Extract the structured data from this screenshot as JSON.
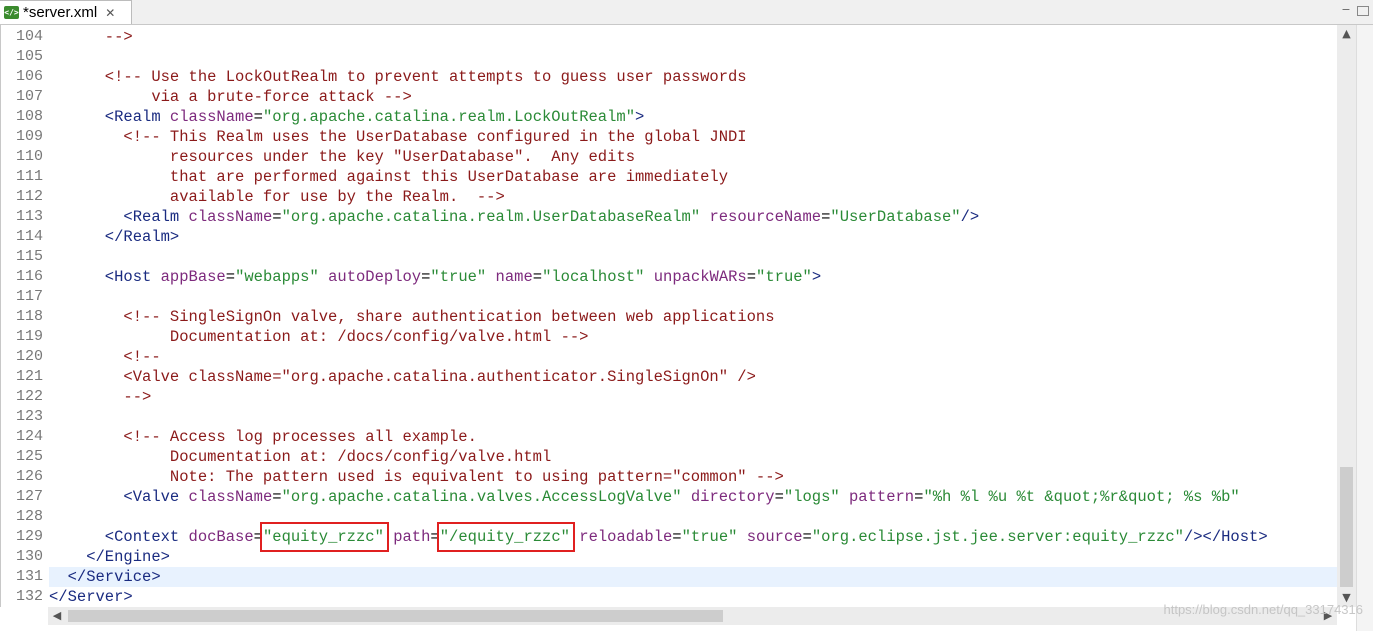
{
  "tab": {
    "title": "*server.xml",
    "icon": "xml-file-icon",
    "icon_text": "</>"
  },
  "window": {
    "minimize": "−",
    "maximize": ""
  },
  "lines": [
    {
      "n": "104",
      "segs": [
        {
          "t": "      -->",
          "c": "cm"
        }
      ]
    },
    {
      "n": "105",
      "segs": []
    },
    {
      "n": "106",
      "segs": [
        {
          "t": "      <!-- Use the LockOutRealm to prevent attempts to guess user passwords",
          "c": "cm"
        }
      ]
    },
    {
      "n": "107",
      "segs": [
        {
          "t": "           via a brute-force attack -->",
          "c": "cm"
        }
      ]
    },
    {
      "n": "108",
      "segs": [
        {
          "t": "      <Realm ",
          "c": "tg"
        },
        {
          "t": "className",
          "c": "at"
        },
        {
          "t": "=",
          "c": ""
        },
        {
          "t": "\"org.apache.catalina.realm.LockOutRealm\"",
          "c": "vl"
        },
        {
          "t": ">",
          "c": "tg"
        }
      ]
    },
    {
      "n": "109",
      "segs": [
        {
          "t": "        <!-- This Realm uses the UserDatabase configured in the global JNDI",
          "c": "cm"
        }
      ]
    },
    {
      "n": "110",
      "segs": [
        {
          "t": "             resources under the key \"UserDatabase\".  Any edits",
          "c": "cm"
        }
      ]
    },
    {
      "n": "111",
      "segs": [
        {
          "t": "             that are performed against this UserDatabase are immediately",
          "c": "cm"
        }
      ]
    },
    {
      "n": "112",
      "segs": [
        {
          "t": "             available for use by the Realm.  -->",
          "c": "cm"
        }
      ]
    },
    {
      "n": "113",
      "segs": [
        {
          "t": "        <Realm ",
          "c": "tg"
        },
        {
          "t": "className",
          "c": "at"
        },
        {
          "t": "=",
          "c": ""
        },
        {
          "t": "\"org.apache.catalina.realm.UserDatabaseRealm\"",
          "c": "vl"
        },
        {
          "t": " ",
          "c": ""
        },
        {
          "t": "resourceName",
          "c": "at"
        },
        {
          "t": "=",
          "c": ""
        },
        {
          "t": "\"UserDatabase\"",
          "c": "vl"
        },
        {
          "t": "/>",
          "c": "tg"
        }
      ]
    },
    {
      "n": "114",
      "segs": [
        {
          "t": "      </Realm>",
          "c": "tg"
        }
      ]
    },
    {
      "n": "115",
      "segs": []
    },
    {
      "n": "116",
      "segs": [
        {
          "t": "      <Host ",
          "c": "tg"
        },
        {
          "t": "appBase",
          "c": "at"
        },
        {
          "t": "=",
          "c": ""
        },
        {
          "t": "\"webapps\"",
          "c": "vl"
        },
        {
          "t": " ",
          "c": ""
        },
        {
          "t": "autoDeploy",
          "c": "at"
        },
        {
          "t": "=",
          "c": ""
        },
        {
          "t": "\"true\"",
          "c": "vl"
        },
        {
          "t": " ",
          "c": ""
        },
        {
          "t": "name",
          "c": "at"
        },
        {
          "t": "=",
          "c": ""
        },
        {
          "t": "\"localhost\"",
          "c": "vl"
        },
        {
          "t": " ",
          "c": ""
        },
        {
          "t": "unpackWARs",
          "c": "at"
        },
        {
          "t": "=",
          "c": ""
        },
        {
          "t": "\"true\"",
          "c": "vl"
        },
        {
          "t": ">",
          "c": "tg"
        }
      ]
    },
    {
      "n": "117",
      "segs": []
    },
    {
      "n": "118",
      "segs": [
        {
          "t": "        <!-- SingleSignOn valve, share authentication between web applications",
          "c": "cm"
        }
      ]
    },
    {
      "n": "119",
      "segs": [
        {
          "t": "             Documentation at: /docs/config/valve.html -->",
          "c": "cm"
        }
      ]
    },
    {
      "n": "120",
      "segs": [
        {
          "t": "        <!--",
          "c": "cm"
        }
      ]
    },
    {
      "n": "121",
      "segs": [
        {
          "t": "        <Valve className=\"org.apache.catalina.authenticator.SingleSignOn\" />",
          "c": "cm"
        }
      ]
    },
    {
      "n": "122",
      "segs": [
        {
          "t": "        -->",
          "c": "cm"
        }
      ]
    },
    {
      "n": "123",
      "segs": []
    },
    {
      "n": "124",
      "segs": [
        {
          "t": "        <!-- Access log processes all example.",
          "c": "cm"
        }
      ]
    },
    {
      "n": "125",
      "segs": [
        {
          "t": "             Documentation at: /docs/config/valve.html",
          "c": "cm"
        }
      ]
    },
    {
      "n": "126",
      "segs": [
        {
          "t": "             Note: The pattern used is equivalent to using pattern=\"common\" -->",
          "c": "cm"
        }
      ]
    },
    {
      "n": "127",
      "segs": [
        {
          "t": "        <Valve ",
          "c": "tg"
        },
        {
          "t": "className",
          "c": "at"
        },
        {
          "t": "=",
          "c": ""
        },
        {
          "t": "\"org.apache.catalina.valves.AccessLogValve\"",
          "c": "vl"
        },
        {
          "t": " ",
          "c": ""
        },
        {
          "t": "directory",
          "c": "at"
        },
        {
          "t": "=",
          "c": ""
        },
        {
          "t": "\"logs\"",
          "c": "vl"
        },
        {
          "t": " ",
          "c": ""
        },
        {
          "t": "pattern",
          "c": "at"
        },
        {
          "t": "=",
          "c": ""
        },
        {
          "t": "\"%h %l %u %t &quot;%r&quot; %s %b\"",
          "c": "vl"
        }
      ]
    },
    {
      "n": "128",
      "segs": []
    },
    {
      "n": "129",
      "segs": [
        {
          "t": "      <Context ",
          "c": "tg"
        },
        {
          "t": "docBase",
          "c": "at"
        },
        {
          "t": "=",
          "c": ""
        },
        {
          "t": "\"equity_rzzc\"",
          "c": "vl",
          "hl": true
        },
        {
          "t": " ",
          "c": ""
        },
        {
          "t": "path",
          "c": "at"
        },
        {
          "t": "=",
          "c": ""
        },
        {
          "t": "\"/equity_rzzc\"",
          "c": "vl",
          "hl": true
        },
        {
          "t": " ",
          "c": ""
        },
        {
          "t": "reloadable",
          "c": "at"
        },
        {
          "t": "=",
          "c": ""
        },
        {
          "t": "\"true\"",
          "c": "vl"
        },
        {
          "t": " ",
          "c": ""
        },
        {
          "t": "source",
          "c": "at"
        },
        {
          "t": "=",
          "c": ""
        },
        {
          "t": "\"org.eclipse.jst.jee.server:equity_rzzc\"",
          "c": "vl"
        },
        {
          "t": "/></Host>",
          "c": "tg"
        }
      ]
    },
    {
      "n": "130",
      "segs": [
        {
          "t": "    </Engine>",
          "c": "tg"
        }
      ]
    },
    {
      "n": "131",
      "segs": [
        {
          "t": "  </Service>",
          "c": "tg"
        }
      ],
      "current": true
    },
    {
      "n": "132",
      "segs": [
        {
          "t": "</Server>",
          "c": "tg"
        }
      ]
    }
  ],
  "watermark": "https://blog.csdn.net/qq_33174316",
  "colors": {
    "comment": "#8b1a1a",
    "tag": "#1a2b80",
    "attribute": "#7d2a7d",
    "value": "#2a8a36",
    "highlight_box": "#e02020",
    "current_line": "#e8f2fe"
  },
  "scroll": {
    "up": "▲",
    "down": "▼",
    "left": "◀",
    "right": "▶",
    "vertical_position": 0.76,
    "horizontal_fraction_visible": 0.51
  }
}
